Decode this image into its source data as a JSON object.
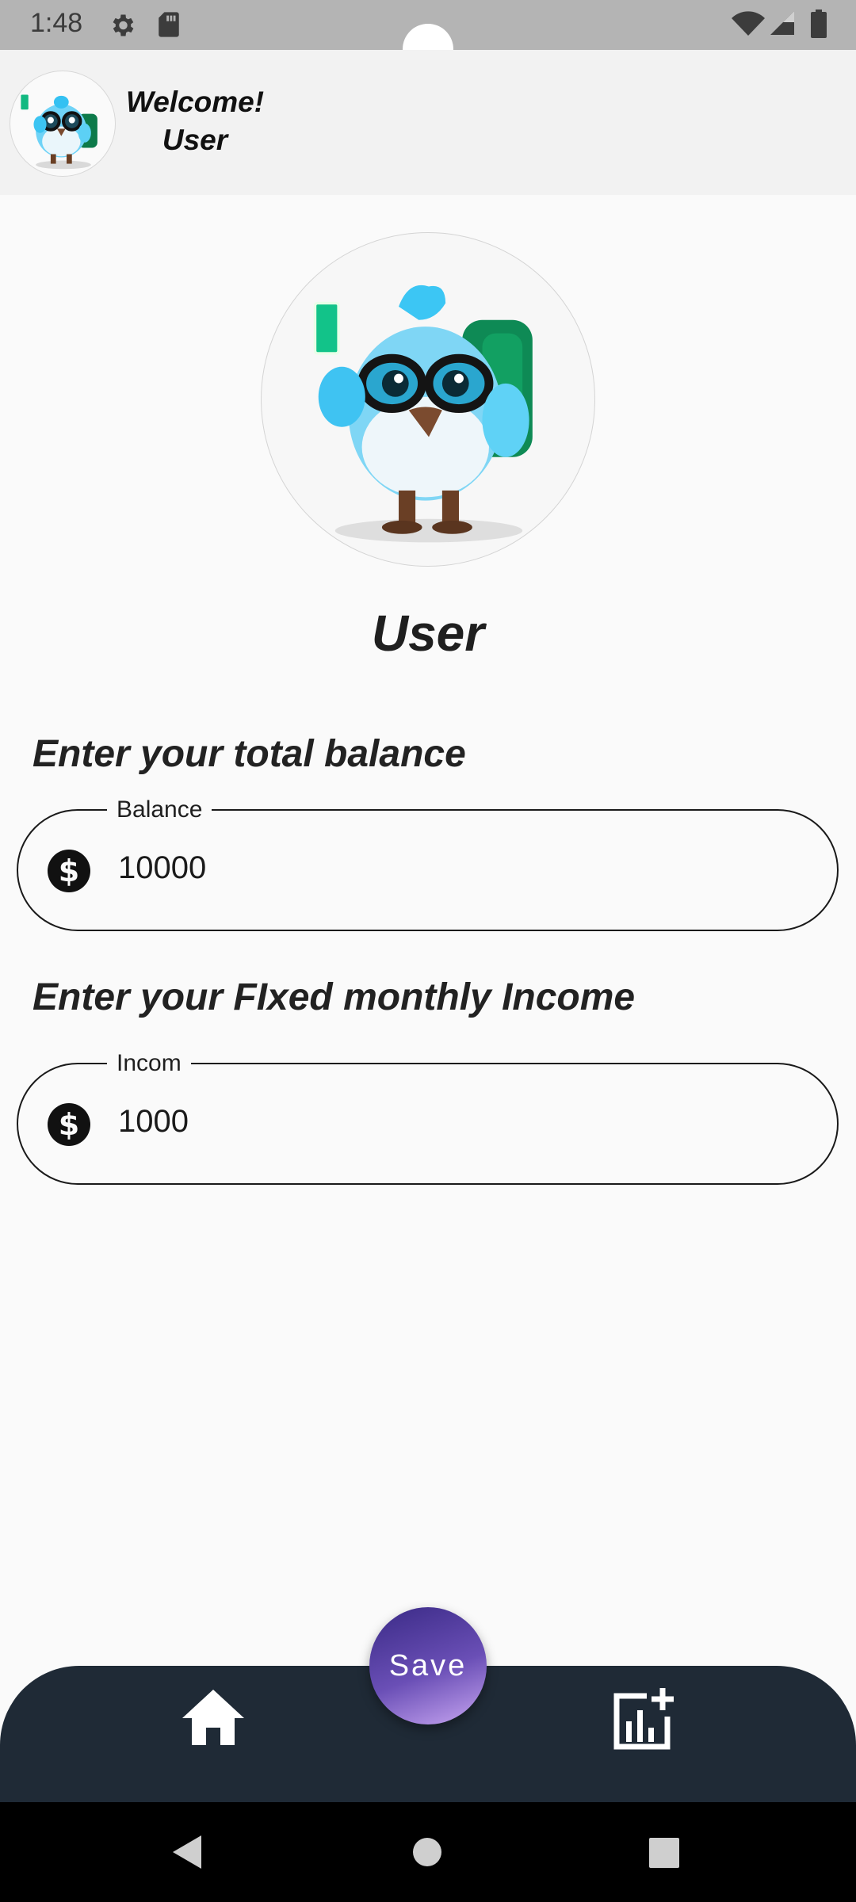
{
  "status_bar": {
    "time": "1:48",
    "icons": [
      "gear-icon",
      "sd-card-icon",
      "wifi-icon",
      "signal-icon",
      "battery-icon"
    ]
  },
  "header": {
    "welcome_line1": "Welcome!",
    "welcome_line2": "User",
    "avatar": "bird-mascot-avatar"
  },
  "profile": {
    "avatar": "bird-mascot-avatar",
    "name": "User"
  },
  "balance_section": {
    "label": "Enter your total balance",
    "field_label": "Balance",
    "value": "10000",
    "icon": "dollar-icon"
  },
  "income_section": {
    "label": "Enter your FIxed monthly Income",
    "field_label": "Incom",
    "value": "1000",
    "icon": "dollar-icon"
  },
  "bottom_bar": {
    "save_label": "Save",
    "left_icon": "home-icon",
    "right_icon": "add-chart-icon"
  },
  "navigation": {
    "icons": [
      "back-icon",
      "home-circle-icon",
      "recents-icon"
    ]
  },
  "colors": {
    "bottom_bar": "#1f2a36",
    "fab_gradient_start": "#3a2a86",
    "fab_gradient_end": "#c8a6f2",
    "background": "#fafafa"
  }
}
